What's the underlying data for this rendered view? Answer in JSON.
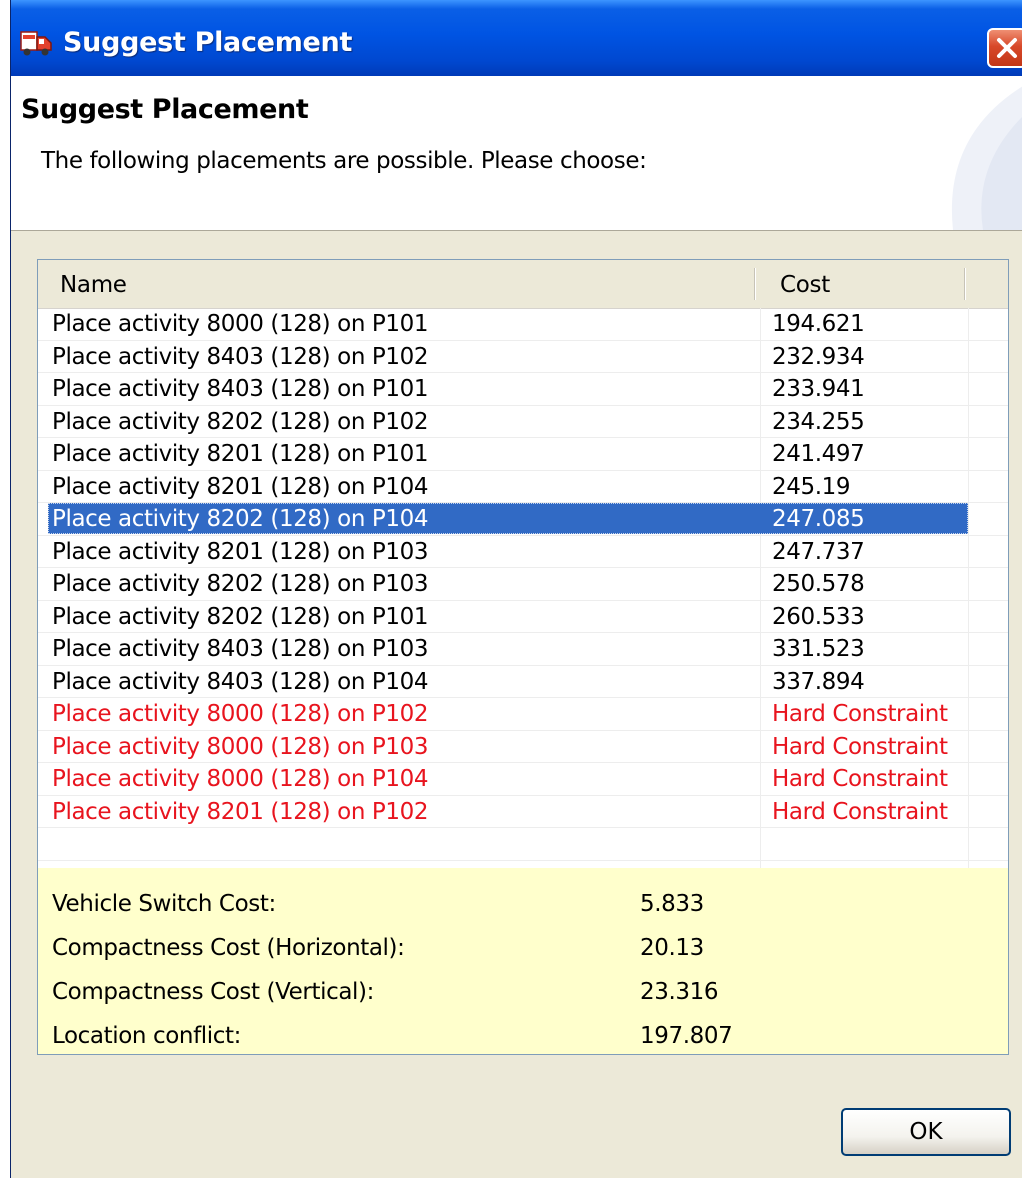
{
  "window": {
    "title": "Suggest Placement"
  },
  "banner": {
    "title": "Suggest Placement",
    "message": "The following placements are possible. Please choose:"
  },
  "table": {
    "columns": [
      "Name",
      "Cost"
    ],
    "rows": [
      {
        "name": "Place activity 8000 (128)  on P101",
        "cost": "194.621",
        "state": "normal"
      },
      {
        "name": "Place activity 8403 (128)  on P102",
        "cost": "232.934",
        "state": "normal"
      },
      {
        "name": "Place activity 8403 (128)  on P101",
        "cost": "233.941",
        "state": "normal"
      },
      {
        "name": "Place activity 8202 (128)  on P102",
        "cost": "234.255",
        "state": "normal"
      },
      {
        "name": "Place activity 8201 (128)  on P101",
        "cost": "241.497",
        "state": "normal"
      },
      {
        "name": "Place activity 8201 (128)  on P104",
        "cost": "245.19",
        "state": "normal"
      },
      {
        "name": "Place activity 8202 (128)  on P104",
        "cost": "247.085",
        "state": "selected"
      },
      {
        "name": "Place activity 8201 (128)  on P103",
        "cost": "247.737",
        "state": "normal"
      },
      {
        "name": "Place activity 8202 (128)  on P103",
        "cost": "250.578",
        "state": "normal"
      },
      {
        "name": "Place activity 8202 (128)  on P101",
        "cost": "260.533",
        "state": "normal"
      },
      {
        "name": "Place activity 8403 (128)  on P103",
        "cost": "331.523",
        "state": "normal"
      },
      {
        "name": "Place activity 8403 (128)  on P104",
        "cost": "337.894",
        "state": "normal"
      },
      {
        "name": "Place activity 8000 (128)  on P102",
        "cost": "Hard Constraint",
        "state": "hard"
      },
      {
        "name": "Place activity 8000 (128)  on P103",
        "cost": "Hard Constraint",
        "state": "hard"
      },
      {
        "name": "Place activity 8000 (128)  on P104",
        "cost": "Hard Constraint",
        "state": "hard"
      },
      {
        "name": "Place activity 8201 (128)  on P102",
        "cost": "Hard Constraint",
        "state": "hard"
      }
    ]
  },
  "stats": [
    {
      "label": "Vehicle Switch Cost:",
      "value": "5.833"
    },
    {
      "label": "Compactness Cost (Horizontal):",
      "value": "20.13"
    },
    {
      "label": "Compactness Cost (Vertical):",
      "value": "23.316"
    },
    {
      "label": "Location conflict:",
      "value": "197.807"
    }
  ],
  "buttons": {
    "ok_label": "OK"
  },
  "colors": {
    "selection": "#316ac5",
    "hard_constraint": "#e8141e",
    "stats_background": "#ffffcc",
    "titlebar": "#0054e3"
  },
  "icons": {
    "app": "truck-app-icon",
    "close": "close-icon"
  }
}
